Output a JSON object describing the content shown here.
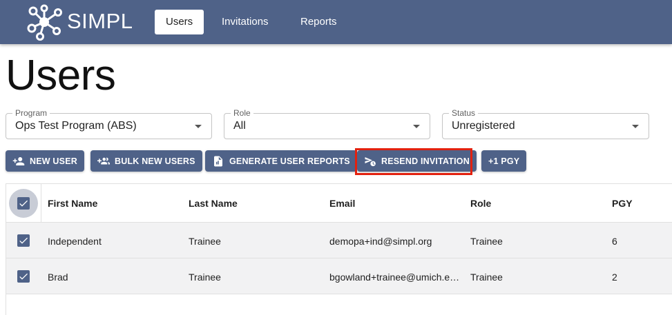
{
  "header": {
    "brand": "SIMPL",
    "tabs": [
      {
        "label": "Users",
        "active": true
      },
      {
        "label": "Invitations",
        "active": false
      },
      {
        "label": "Reports",
        "active": false
      }
    ]
  },
  "page": {
    "title": "Users"
  },
  "filters": [
    {
      "label": "Program",
      "value": "Ops Test Program (ABS)"
    },
    {
      "label": "Role",
      "value": "All"
    },
    {
      "label": "Status",
      "value": "Unregistered"
    }
  ],
  "toolbar": {
    "new_user": "NEW USER",
    "bulk_new_users": "BULK NEW USERS",
    "generate_reports": "GENERATE USER REPORTS",
    "resend_invitation": "RESEND INVITATION",
    "plus_pgy": "+1 PGY"
  },
  "table": {
    "columns": [
      "First Name",
      "Last Name",
      "Email",
      "Role",
      "PGY"
    ],
    "rows": [
      {
        "first": "Independent",
        "last": "Trainee",
        "email": "demopa+ind@simpl.org",
        "role": "Trainee",
        "pgy": "6",
        "checked": true
      },
      {
        "first": "Brad",
        "last": "Trainee",
        "email": "bgowland+trainee@umich.e…",
        "role": "Trainee",
        "pgy": "2",
        "checked": true
      }
    ]
  },
  "colors": {
    "primary": "#4f6288",
    "highlight": "#e3210f",
    "row_bg": "#f2f2f3"
  }
}
